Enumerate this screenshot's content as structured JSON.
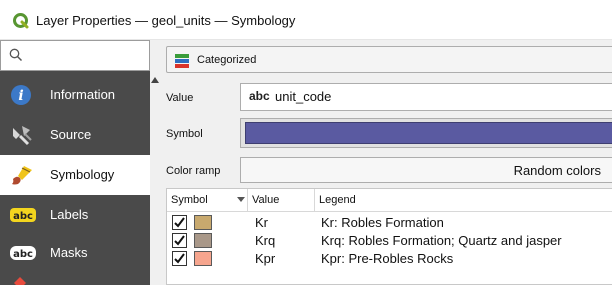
{
  "window": {
    "title": "Layer Properties — geol_units — Symbology",
    "app_icon": "qgis-icon"
  },
  "sidebar": {
    "search_icon": "search-icon",
    "items": [
      {
        "label": "Information",
        "icon": "information-icon"
      },
      {
        "label": "Source",
        "icon": "source-icon"
      },
      {
        "label": "Symbology",
        "icon": "symbology-paintbrush-icon",
        "active": true
      },
      {
        "label": "Labels",
        "icon": "labels-abc-icon"
      },
      {
        "label": "Masks",
        "icon": "masks-abc-icon"
      }
    ]
  },
  "main": {
    "renderer": {
      "label": "Categorized",
      "icon": "categorized-renderer-icon"
    },
    "value": {
      "label": "Value",
      "field_type": "abc",
      "field": "unit_code"
    },
    "symbol": {
      "label": "Symbol",
      "color": "#5a5aa1"
    },
    "color_ramp": {
      "label": "Color ramp",
      "value": "Random colors"
    },
    "table": {
      "headers": [
        "Symbol",
        "Value",
        "Legend"
      ],
      "rows": [
        {
          "checked": true,
          "color": "#c8a96e",
          "value": "Kr",
          "legend": "Kr: Robles Formation"
        },
        {
          "checked": true,
          "color": "#a99889",
          "value": "Krq",
          "legend": "Krq: Robles Formation; Quartz and jasper"
        },
        {
          "checked": true,
          "color": "#f6a58e",
          "value": "Kpr",
          "legend": "Kpr: Pre-Robles Rocks"
        }
      ]
    }
  }
}
